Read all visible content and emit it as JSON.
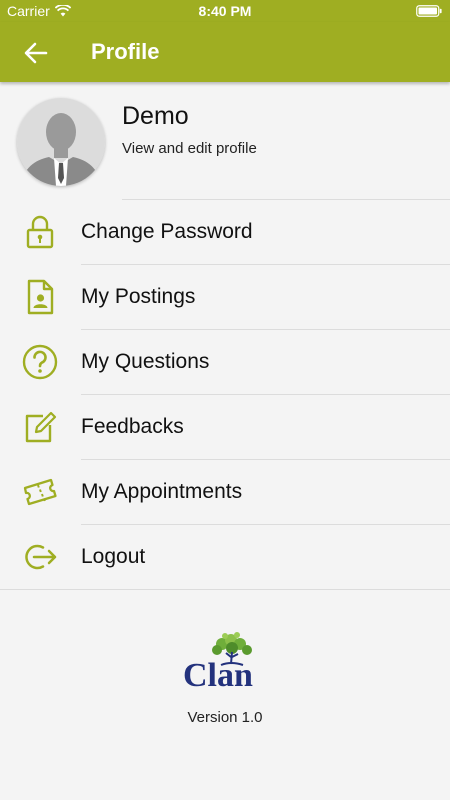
{
  "status_bar": {
    "carrier": "Carrier",
    "time": "8:40 PM"
  },
  "nav": {
    "title": "Profile",
    "back_icon": "arrow-left-icon"
  },
  "profile": {
    "name": "Demo",
    "subtitle": "View and edit profile"
  },
  "menu": {
    "items": [
      {
        "label": "Change Password",
        "icon": "lock-icon"
      },
      {
        "label": "My Postings",
        "icon": "posting-document-icon"
      },
      {
        "label": "My Questions",
        "icon": "question-circle-icon"
      },
      {
        "label": "Feedbacks",
        "icon": "edit-feedback-icon"
      },
      {
        "label": "My Appointments",
        "icon": "ticket-icon"
      },
      {
        "label": "Logout",
        "icon": "logout-icon"
      }
    ]
  },
  "footer": {
    "logo_text": "Clan",
    "version": "Version 1.0"
  },
  "colors": {
    "accent": "#9fae22",
    "background": "#f4f4f4",
    "logo_blue": "#23327d"
  }
}
